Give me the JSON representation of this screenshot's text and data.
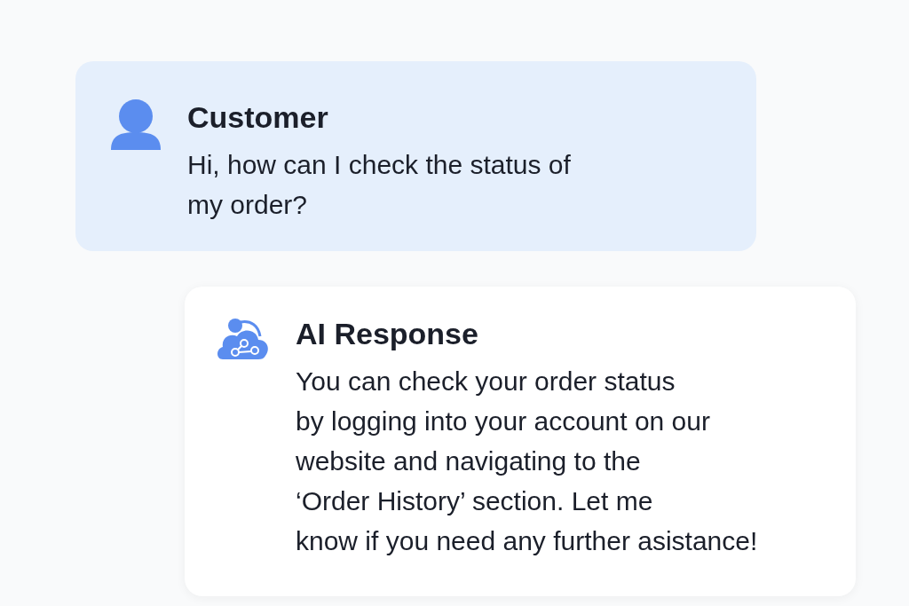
{
  "messages": [
    {
      "kind": "customer",
      "sender": "Customer",
      "text": "Hi, how can I check the status of\nmy order?"
    },
    {
      "kind": "ai",
      "sender": "AI Response",
      "text": "You can check your order status\nby logging into your account on our\nwebsite and navigating to the\n‘Order History’ section. Let me\nknow if you need any further asistance!"
    }
  ]
}
